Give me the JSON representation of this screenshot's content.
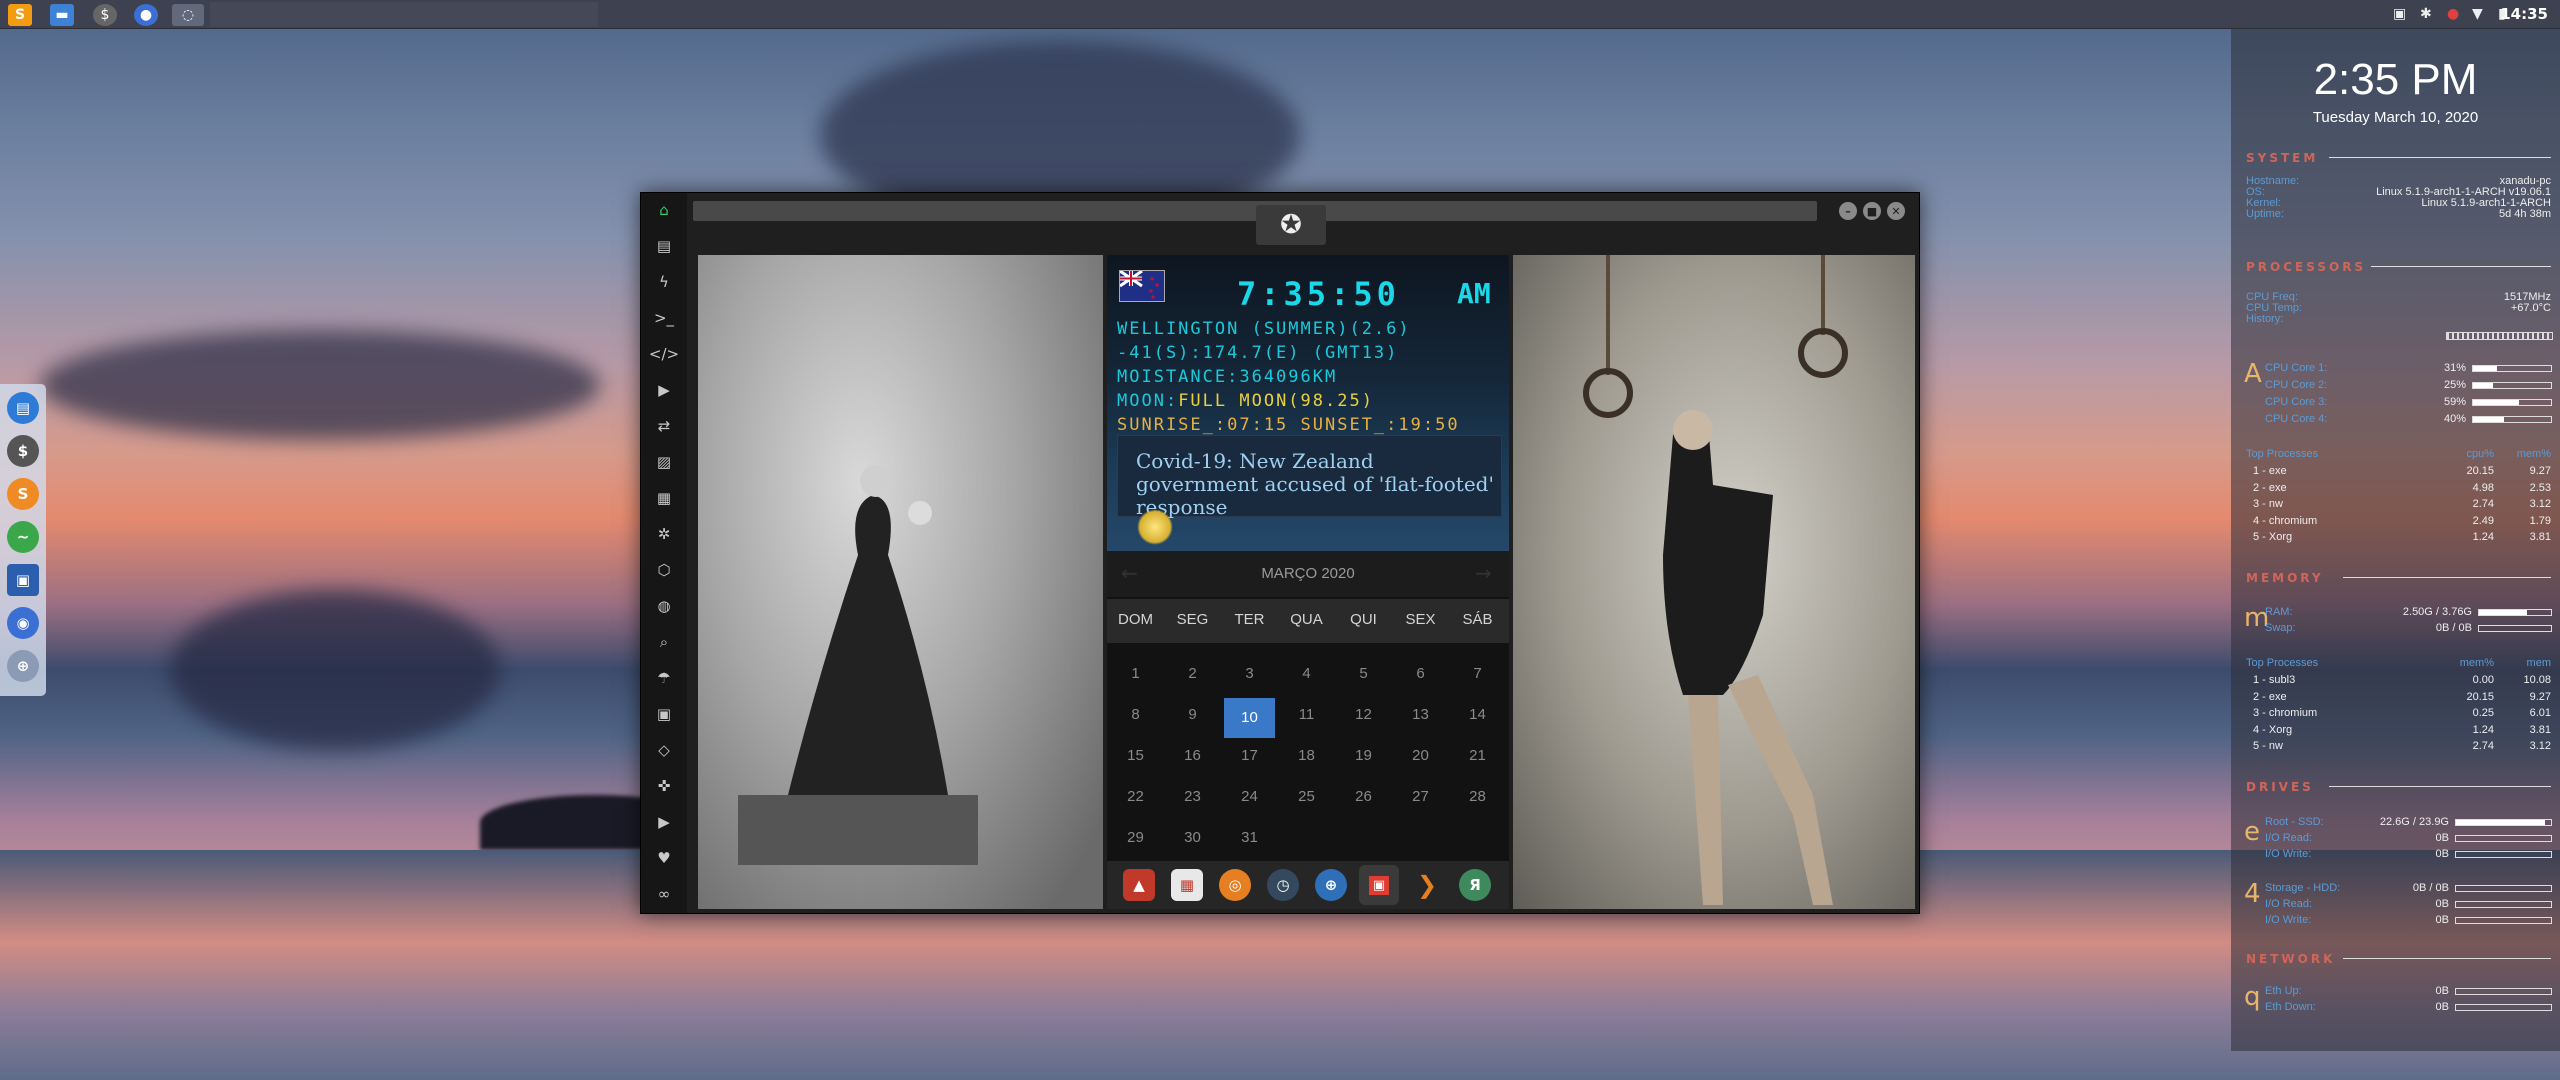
{
  "taskbar": {
    "clock": "14:35",
    "tray_icons": [
      "photo-icon",
      "bluetooth-icon",
      "record-icon",
      "wifi-icon",
      "battery-icon"
    ],
    "apps": [
      "sublime-text",
      "files",
      "system-monitor",
      "chromium",
      "window"
    ]
  },
  "dock": {
    "icons": [
      "files-icon",
      "system-monitor-icon",
      "sublime-icon",
      "pulse-icon",
      "screenshot-icon",
      "chromium-icon",
      "network-icon"
    ]
  },
  "window": {
    "sidebar_icons": [
      "home-icon",
      "document-icon",
      "lightning-icon",
      "terminal-icon",
      "code-icon",
      "play-icon",
      "translate-icon",
      "image-icon",
      "news-icon",
      "settings-icon",
      "hexagon-icon",
      "globe-icon",
      "search-icon",
      "umbrella-icon",
      "contact-icon",
      "tag-icon",
      "expand-icon",
      "youtube-icon",
      "heart-icon",
      "link-icon"
    ],
    "world_clock": {
      "time": "7:35:50",
      "ampm": "AM",
      "line1": "WELLINGTON (SUMMER)(2.6)",
      "line2": "-41(S):174.7(E) (GMT13)",
      "line3": "MOISTANCE:364096KM",
      "line4_label": "MOON:",
      "line4_value": "FULL MOON(98.25)",
      "line5": "SUNRISE_:07:15 SUNSET_:19:50",
      "news": "Covid-19: New Zealand government accused of 'flat-footed' response"
    },
    "calendar": {
      "month": "MARÇO 2020",
      "prev": "←",
      "next": "→",
      "weekdays": [
        "DOM",
        "SEG",
        "TER",
        "QUA",
        "QUI",
        "SEX",
        "SÁB"
      ],
      "weeks": [
        [
          "1",
          "2",
          "3",
          "4",
          "5",
          "6",
          "7"
        ],
        [
          "8",
          "9",
          "10",
          "11",
          "12",
          "13",
          "14"
        ],
        [
          "15",
          "16",
          "17",
          "18",
          "19",
          "20",
          "21"
        ],
        [
          "22",
          "23",
          "24",
          "25",
          "26",
          "27",
          "28"
        ],
        [
          "29",
          "30",
          "31",
          "",
          "",
          "",
          ""
        ]
      ],
      "today": "10"
    },
    "app_bar": [
      "alarm-app",
      "calendar-app",
      "search-app",
      "clock-app",
      "globe-app",
      "date-app",
      "arrow-app",
      "yandex-app"
    ]
  },
  "conky": {
    "time": "2:35 PM",
    "date": "Tuesday March 10, 2020",
    "system_section": "SYSTEM",
    "system": [
      {
        "k": "Hostname:",
        "v": "xanadu-pc"
      },
      {
        "k": "OS:",
        "v": "Linux 5.1.9-arch1-1-ARCH v19.06.1"
      },
      {
        "k": "Kernel:",
        "v": "Linux 5.1.9-arch1-1-ARCH"
      },
      {
        "k": "Uptime:",
        "v": "5d 4h 38m"
      }
    ],
    "processors_section": "PROCESSORS",
    "cpu": [
      {
        "k": "CPU Freq:",
        "v": "1517MHz"
      },
      {
        "k": "CPU Temp:",
        "v": "+67.0°C"
      },
      {
        "k": "History:",
        "v": ""
      }
    ],
    "cpu_glyph": "A",
    "cores": [
      {
        "k": "CPU Core 1:",
        "v": "31%",
        "pct": 0.31
      },
      {
        "k": "CPU Core 2:",
        "v": "25%",
        "pct": 0.25
      },
      {
        "k": "CPU Core 3:",
        "v": "59%",
        "pct": 0.59
      },
      {
        "k": "CPU Core 4:",
        "v": "40%",
        "pct": 0.4
      }
    ],
    "top_cpu_header": {
      "k": "Top Processes",
      "c1": "cpu%",
      "c2": "mem%"
    },
    "top_cpu": [
      {
        "n": "1 - exe",
        "a": "20.15",
        "b": "9.27"
      },
      {
        "n": "2 - exe",
        "a": "4.98",
        "b": "2.53"
      },
      {
        "n": "3 - nw",
        "a": "2.74",
        "b": "3.12"
      },
      {
        "n": "4 - chromium",
        "a": "2.49",
        "b": "1.79"
      },
      {
        "n": "5 - Xorg",
        "a": "1.24",
        "b": "3.81"
      }
    ],
    "memory_section": "MEMORY",
    "mem_glyph": "m",
    "mem": [
      {
        "k": "RAM:",
        "v": "2.50G / 3.76G",
        "pct": 0.66
      },
      {
        "k": "Swap:",
        "v": "0B / 0B",
        "pct": 0
      }
    ],
    "top_mem_header": {
      "k": "Top Processes",
      "c1": "mem%",
      "c2": "mem"
    },
    "top_mem": [
      {
        "n": "1 - subl3",
        "a": "0.00",
        "b": "10.08"
      },
      {
        "n": "2 - exe",
        "a": "20.15",
        "b": "9.27"
      },
      {
        "n": "3 - chromium",
        "a": "0.25",
        "b": "6.01"
      },
      {
        "n": "4 - Xorg",
        "a": "1.24",
        "b": "3.81"
      },
      {
        "n": "5 - nw",
        "a": "2.74",
        "b": "3.12"
      }
    ],
    "drives_section": "DRIVES",
    "drive_glyph": "e",
    "drives": [
      {
        "k": "Root - SSD:",
        "v": "22.6G / 23.9G",
        "pct": 0.94
      },
      {
        "k": "I/O Read:",
        "v": "0B",
        "pct": 0
      },
      {
        "k": "I/O Write:",
        "v": "0B",
        "pct": 0
      }
    ],
    "storage_glyph": "4",
    "storage": [
      {
        "k": "Storage - HDD:",
        "v": "0B / 0B",
        "pct": 0
      },
      {
        "k": "I/O Read:",
        "v": "0B",
        "pct": 0
      },
      {
        "k": "I/O Write:",
        "v": "0B",
        "pct": 0
      }
    ],
    "network_section": "NETWORK",
    "net_glyph": "q",
    "net": [
      {
        "k": "Eth Up:",
        "v": "0B",
        "pct": 0
      },
      {
        "k": "Eth Down:",
        "v": "0B",
        "pct": 0
      }
    ]
  }
}
